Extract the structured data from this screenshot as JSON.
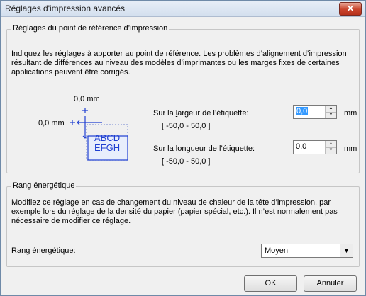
{
  "window": {
    "title": "Réglages d'impression avancés",
    "close_label": "✕"
  },
  "reference_group": {
    "legend": "Réglages du point de référence d’impression",
    "description": "Indiquez les réglages à apporter au point de référence. Les problèmes d’alignement d’impression résultant de différences au niveau des modèles d’imprimantes ou les marges fixes de certaines applications peuvent être corrigés.",
    "diagram": {
      "top_label": "0,0 mm",
      "left_label": "0,0 mm",
      "sample_line1": "ABCD",
      "sample_line2": "EFGH"
    },
    "width_field": {
      "label_pre": "Sur la ",
      "label_access": "l",
      "label_post": "argeur de l’étiquette:",
      "range": "[ -50,0 - 50,0 ]",
      "value": "0,0",
      "unit": "mm"
    },
    "length_field": {
      "label": "Sur la longueur de l’étiquette:",
      "range": "[ -50,0 - 50,0 ]",
      "value": "0,0",
      "unit": "mm"
    }
  },
  "energy_group": {
    "legend": "Rang énergétique",
    "description": "Modifiez ce réglage en cas de changement du niveau de chaleur de la tête d’impression, par exemple lors du réglage de la densité du papier (papier spécial, etc.). Il n’est normalement pas nécessaire de modifier ce réglage.",
    "label_access": "R",
    "label_rest": "ang énergétique:",
    "selected": "Moyen"
  },
  "buttons": {
    "ok": "OK",
    "cancel": "Annuler"
  },
  "colors": {
    "accent_blue": "#1f3fd1",
    "selection": "#3399ff"
  }
}
